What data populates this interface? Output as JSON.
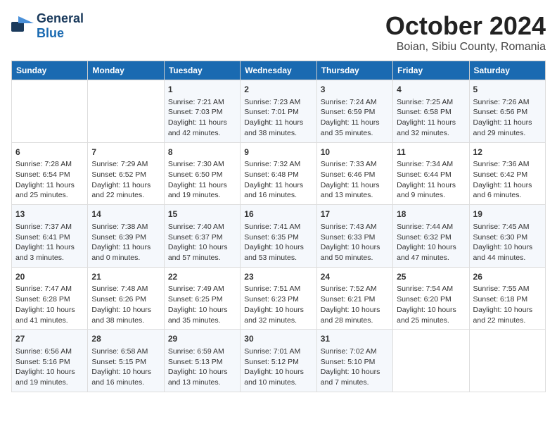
{
  "logo": {
    "general": "General",
    "blue": "Blue"
  },
  "title": "October 2024",
  "subtitle": "Boian, Sibiu County, Romania",
  "days_of_week": [
    "Sunday",
    "Monday",
    "Tuesday",
    "Wednesday",
    "Thursday",
    "Friday",
    "Saturday"
  ],
  "weeks": [
    [
      {
        "day": "",
        "sunrise": "",
        "sunset": "",
        "daylight": ""
      },
      {
        "day": "",
        "sunrise": "",
        "sunset": "",
        "daylight": ""
      },
      {
        "day": "1",
        "sunrise": "Sunrise: 7:21 AM",
        "sunset": "Sunset: 7:03 PM",
        "daylight": "Daylight: 11 hours and 42 minutes."
      },
      {
        "day": "2",
        "sunrise": "Sunrise: 7:23 AM",
        "sunset": "Sunset: 7:01 PM",
        "daylight": "Daylight: 11 hours and 38 minutes."
      },
      {
        "day": "3",
        "sunrise": "Sunrise: 7:24 AM",
        "sunset": "Sunset: 6:59 PM",
        "daylight": "Daylight: 11 hours and 35 minutes."
      },
      {
        "day": "4",
        "sunrise": "Sunrise: 7:25 AM",
        "sunset": "Sunset: 6:58 PM",
        "daylight": "Daylight: 11 hours and 32 minutes."
      },
      {
        "day": "5",
        "sunrise": "Sunrise: 7:26 AM",
        "sunset": "Sunset: 6:56 PM",
        "daylight": "Daylight: 11 hours and 29 minutes."
      }
    ],
    [
      {
        "day": "6",
        "sunrise": "Sunrise: 7:28 AM",
        "sunset": "Sunset: 6:54 PM",
        "daylight": "Daylight: 11 hours and 25 minutes."
      },
      {
        "day": "7",
        "sunrise": "Sunrise: 7:29 AM",
        "sunset": "Sunset: 6:52 PM",
        "daylight": "Daylight: 11 hours and 22 minutes."
      },
      {
        "day": "8",
        "sunrise": "Sunrise: 7:30 AM",
        "sunset": "Sunset: 6:50 PM",
        "daylight": "Daylight: 11 hours and 19 minutes."
      },
      {
        "day": "9",
        "sunrise": "Sunrise: 7:32 AM",
        "sunset": "Sunset: 6:48 PM",
        "daylight": "Daylight: 11 hours and 16 minutes."
      },
      {
        "day": "10",
        "sunrise": "Sunrise: 7:33 AM",
        "sunset": "Sunset: 6:46 PM",
        "daylight": "Daylight: 11 hours and 13 minutes."
      },
      {
        "day": "11",
        "sunrise": "Sunrise: 7:34 AM",
        "sunset": "Sunset: 6:44 PM",
        "daylight": "Daylight: 11 hours and 9 minutes."
      },
      {
        "day": "12",
        "sunrise": "Sunrise: 7:36 AM",
        "sunset": "Sunset: 6:42 PM",
        "daylight": "Daylight: 11 hours and 6 minutes."
      }
    ],
    [
      {
        "day": "13",
        "sunrise": "Sunrise: 7:37 AM",
        "sunset": "Sunset: 6:41 PM",
        "daylight": "Daylight: 11 hours and 3 minutes."
      },
      {
        "day": "14",
        "sunrise": "Sunrise: 7:38 AM",
        "sunset": "Sunset: 6:39 PM",
        "daylight": "Daylight: 11 hours and 0 minutes."
      },
      {
        "day": "15",
        "sunrise": "Sunrise: 7:40 AM",
        "sunset": "Sunset: 6:37 PM",
        "daylight": "Daylight: 10 hours and 57 minutes."
      },
      {
        "day": "16",
        "sunrise": "Sunrise: 7:41 AM",
        "sunset": "Sunset: 6:35 PM",
        "daylight": "Daylight: 10 hours and 53 minutes."
      },
      {
        "day": "17",
        "sunrise": "Sunrise: 7:43 AM",
        "sunset": "Sunset: 6:33 PM",
        "daylight": "Daylight: 10 hours and 50 minutes."
      },
      {
        "day": "18",
        "sunrise": "Sunrise: 7:44 AM",
        "sunset": "Sunset: 6:32 PM",
        "daylight": "Daylight: 10 hours and 47 minutes."
      },
      {
        "day": "19",
        "sunrise": "Sunrise: 7:45 AM",
        "sunset": "Sunset: 6:30 PM",
        "daylight": "Daylight: 10 hours and 44 minutes."
      }
    ],
    [
      {
        "day": "20",
        "sunrise": "Sunrise: 7:47 AM",
        "sunset": "Sunset: 6:28 PM",
        "daylight": "Daylight: 10 hours and 41 minutes."
      },
      {
        "day": "21",
        "sunrise": "Sunrise: 7:48 AM",
        "sunset": "Sunset: 6:26 PM",
        "daylight": "Daylight: 10 hours and 38 minutes."
      },
      {
        "day": "22",
        "sunrise": "Sunrise: 7:49 AM",
        "sunset": "Sunset: 6:25 PM",
        "daylight": "Daylight: 10 hours and 35 minutes."
      },
      {
        "day": "23",
        "sunrise": "Sunrise: 7:51 AM",
        "sunset": "Sunset: 6:23 PM",
        "daylight": "Daylight: 10 hours and 32 minutes."
      },
      {
        "day": "24",
        "sunrise": "Sunrise: 7:52 AM",
        "sunset": "Sunset: 6:21 PM",
        "daylight": "Daylight: 10 hours and 28 minutes."
      },
      {
        "day": "25",
        "sunrise": "Sunrise: 7:54 AM",
        "sunset": "Sunset: 6:20 PM",
        "daylight": "Daylight: 10 hours and 25 minutes."
      },
      {
        "day": "26",
        "sunrise": "Sunrise: 7:55 AM",
        "sunset": "Sunset: 6:18 PM",
        "daylight": "Daylight: 10 hours and 22 minutes."
      }
    ],
    [
      {
        "day": "27",
        "sunrise": "Sunrise: 6:56 AM",
        "sunset": "Sunset: 5:16 PM",
        "daylight": "Daylight: 10 hours and 19 minutes."
      },
      {
        "day": "28",
        "sunrise": "Sunrise: 6:58 AM",
        "sunset": "Sunset: 5:15 PM",
        "daylight": "Daylight: 10 hours and 16 minutes."
      },
      {
        "day": "29",
        "sunrise": "Sunrise: 6:59 AM",
        "sunset": "Sunset: 5:13 PM",
        "daylight": "Daylight: 10 hours and 13 minutes."
      },
      {
        "day": "30",
        "sunrise": "Sunrise: 7:01 AM",
        "sunset": "Sunset: 5:12 PM",
        "daylight": "Daylight: 10 hours and 10 minutes."
      },
      {
        "day": "31",
        "sunrise": "Sunrise: 7:02 AM",
        "sunset": "Sunset: 5:10 PM",
        "daylight": "Daylight: 10 hours and 7 minutes."
      },
      {
        "day": "",
        "sunrise": "",
        "sunset": "",
        "daylight": ""
      },
      {
        "day": "",
        "sunrise": "",
        "sunset": "",
        "daylight": ""
      }
    ]
  ]
}
